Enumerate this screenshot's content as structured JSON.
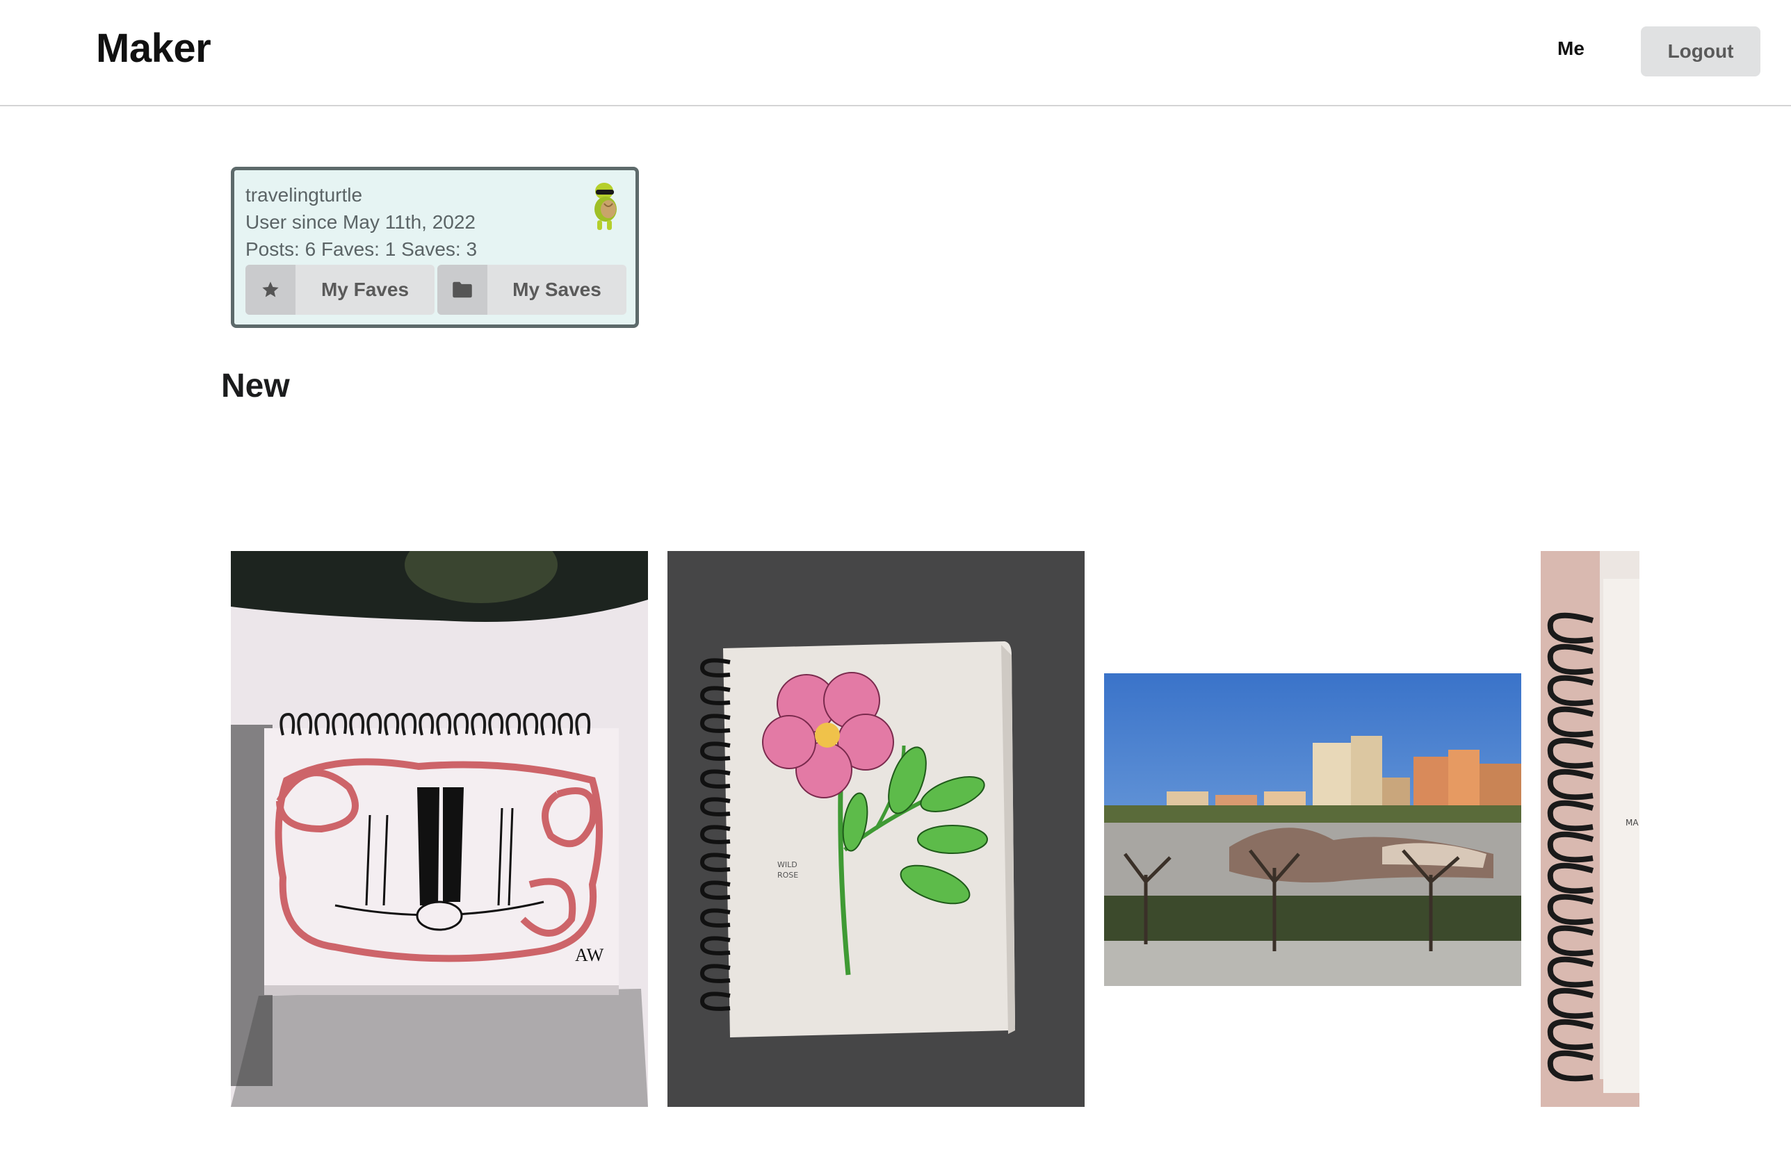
{
  "header": {
    "brand": "Maker",
    "nav_me": "Me",
    "logout_label": "Logout"
  },
  "profile": {
    "username": "travelingturtle",
    "member_since": "User since May 11th, 2022",
    "stats": "Posts: 6 Faves: 1 Saves: 3",
    "avatar_icon": "turtle-sunglasses-avatar",
    "faves_button": {
      "label": "My Faves",
      "icon": "star-icon"
    },
    "saves_button": {
      "label": "My Saves",
      "icon": "folder-icon"
    }
  },
  "section": {
    "title": "New"
  },
  "posts": [
    {
      "name": "post-sketch-friends",
      "notebook_signature": "AW"
    },
    {
      "name": "post-wild-rose",
      "notebook_caption_line1": "WILD",
      "notebook_caption_line2": "ROSE"
    },
    {
      "name": "post-park-photo"
    },
    {
      "name": "post-notebook-spiral",
      "notebook_caption": "MA"
    }
  ],
  "colors": {
    "card_bg": "#e6f4f3",
    "card_border": "#5d6a6b",
    "button_bg": "#e0e1e2",
    "button_icon_bg": "#cacbcd"
  }
}
